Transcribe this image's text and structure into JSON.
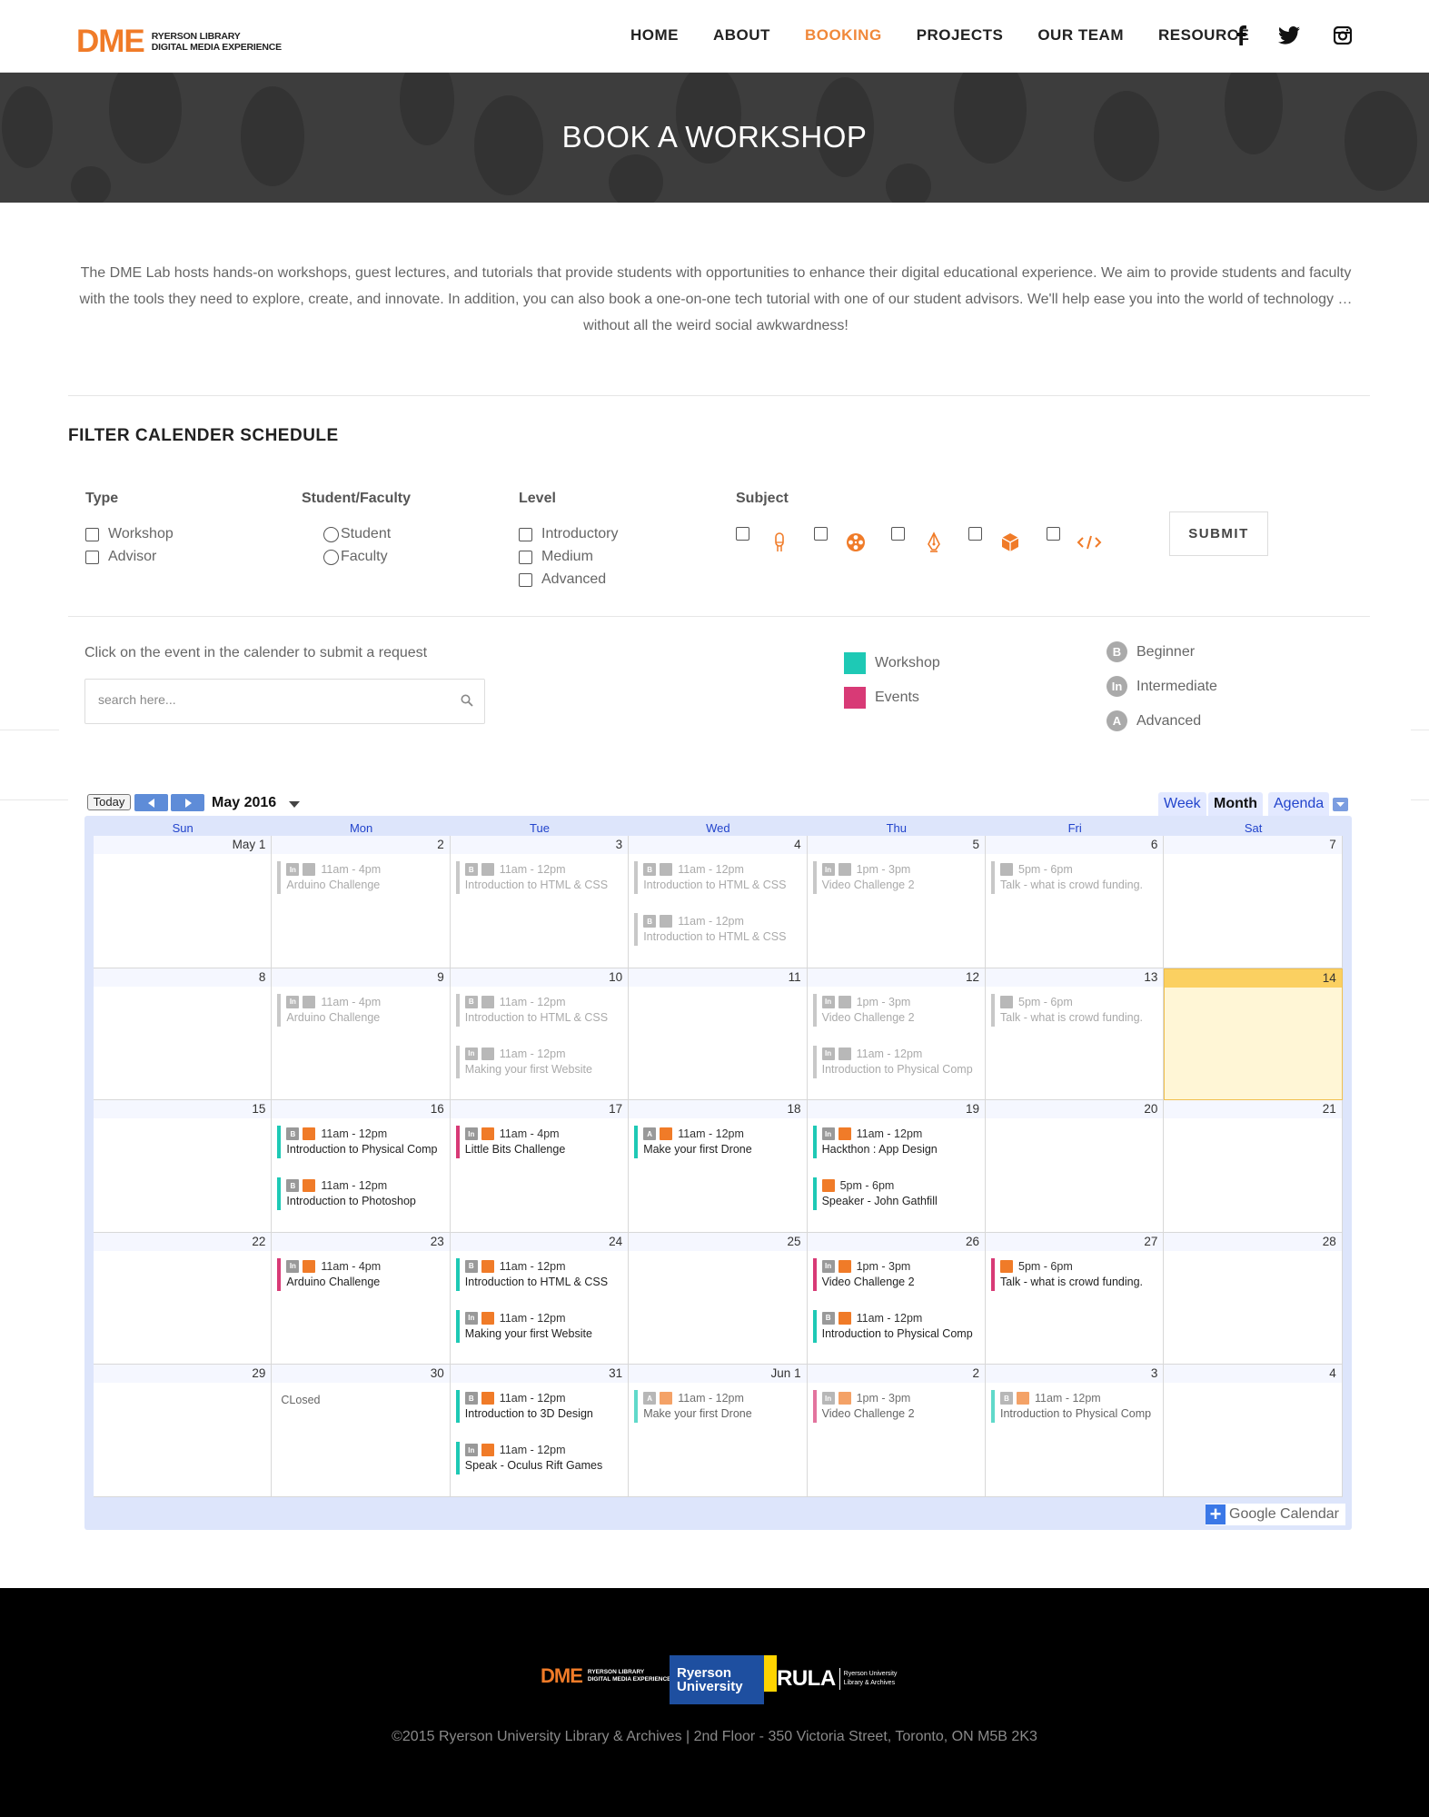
{
  "header": {
    "logo_mark": "DME",
    "logo_line1": "RYERSON LIBRARY",
    "logo_line2": "DIGITAL MEDIA EXPERIENCE",
    "nav": [
      "HOME",
      "ABOUT",
      "BOOKING",
      "PROJECTS",
      "OUR TEAM",
      "RESOURCE"
    ],
    "active_nav": "BOOKING",
    "social_icons": [
      "facebook-icon",
      "twitter-icon",
      "instagram-icon"
    ]
  },
  "hero": {
    "title": "BOOK A WORKSHOP"
  },
  "intro": "The DME Lab hosts hands-on workshops, guest lectures, and tutorials that provide students with opportunities to enhance their digital educational experience. We aim to provide students and faculty with the tools they need to explore, create, and innovate. In addition, you can also book a one-on-one tech tutorial with one of our student advisors. We'll help ease you into the world of technology … without all the weird social awkwardness!",
  "filter": {
    "title": "FILTER CALENDER SCHEDULE",
    "type_label": "Type",
    "type_options": [
      "Workshop",
      "Advisor"
    ],
    "audience_label": "Student/Faculty",
    "audience_options": [
      "Student",
      "Faculty"
    ],
    "level_label": "Level",
    "level_options": [
      "Introductory",
      "Medium",
      "Advanced"
    ],
    "subject_label": "Subject",
    "subject_icons": [
      "electronics-icon",
      "film-reel-icon",
      "pen-nib-icon",
      "cube-icon",
      "code-icon"
    ],
    "submit_label": "SUBMIT"
  },
  "hint": "Click on the event in the calender to submit a request",
  "search": {
    "placeholder": "search here..."
  },
  "legend": {
    "types": [
      {
        "label": "Workshop",
        "color": "#1ec9b5"
      },
      {
        "label": "Events",
        "color": "#d83a76"
      }
    ],
    "levels": [
      {
        "letter": "B",
        "label": "Beginner"
      },
      {
        "letter": "In",
        "label": "Intermediate"
      },
      {
        "letter": "A",
        "label": "Advanced"
      }
    ]
  },
  "calendar": {
    "today_label": "Today",
    "title": "May 2016",
    "views": [
      "Week",
      "Month",
      "Agenda"
    ],
    "selected_view": "Month",
    "days": [
      "Sun",
      "Mon",
      "Tue",
      "Wed",
      "Thu",
      "Fri",
      "Sat"
    ],
    "weeks": [
      [
        "May 1",
        "2",
        "3",
        "4",
        "5",
        "6",
        "7"
      ],
      [
        "8",
        "9",
        "10",
        "11",
        "12",
        "13",
        "14"
      ],
      [
        "15",
        "16",
        "17",
        "18",
        "19",
        "20",
        "21"
      ],
      [
        "22",
        "23",
        "24",
        "25",
        "26",
        "27",
        "28"
      ],
      [
        "29",
        "30",
        "31",
        "Jun 1",
        "2",
        "3",
        "4"
      ]
    ],
    "today_cell": [
      1,
      6
    ],
    "closed_label": "CLosed",
    "badge_text": "Google Calendar",
    "events": [
      {
        "w": 0,
        "d": 1,
        "s": 0,
        "lvl": "In",
        "time": "11am - 4pm",
        "title": "Arduino Challenge",
        "faded": true
      },
      {
        "w": 0,
        "d": 2,
        "s": 0,
        "lvl": "B",
        "time": "11am - 12pm",
        "title": "Introduction to HTML & CSS",
        "faded": true
      },
      {
        "w": 0,
        "d": 3,
        "s": 0,
        "lvl": "B",
        "time": "11am - 12pm",
        "title": "Introduction to HTML & CSS",
        "faded": true
      },
      {
        "w": 0,
        "d": 3,
        "s": 1,
        "lvl": "B",
        "time": "11am - 12pm",
        "title": "Introduction to HTML & CSS",
        "faded": true
      },
      {
        "w": 0,
        "d": 4,
        "s": 0,
        "lvl": "In",
        "time": "1pm - 3pm",
        "title": "Video Challenge 2",
        "faded": true
      },
      {
        "w": 0,
        "d": 5,
        "s": 0,
        "lvl": "",
        "time": "5pm - 6pm",
        "title": "Talk - what is crowd funding.",
        "faded": true
      },
      {
        "w": 1,
        "d": 1,
        "s": 0,
        "lvl": "In",
        "time": "11am - 4pm",
        "title": "Arduino Challenge",
        "faded": true
      },
      {
        "w": 1,
        "d": 2,
        "s": 0,
        "lvl": "B",
        "time": "11am - 12pm",
        "title": "Introduction to HTML & CSS",
        "faded": true
      },
      {
        "w": 1,
        "d": 2,
        "s": 1,
        "lvl": "In",
        "time": "11am - 12pm",
        "title": "Making your first Website",
        "faded": true
      },
      {
        "w": 1,
        "d": 4,
        "s": 0,
        "lvl": "In",
        "time": "1pm - 3pm",
        "title": "Video Challenge 2",
        "faded": true
      },
      {
        "w": 1,
        "d": 4,
        "s": 1,
        "lvl": "In",
        "time": "11am - 12pm",
        "title": "Introduction to Physical Comp",
        "faded": true
      },
      {
        "w": 1,
        "d": 5,
        "s": 0,
        "lvl": "",
        "time": "5pm - 6pm",
        "title": "Talk - what is crowd funding.",
        "faded": true
      },
      {
        "w": 2,
        "d": 1,
        "s": 0,
        "lvl": "B",
        "time": "11am - 12pm",
        "title": "Introduction to Physical Comp",
        "color": "#1ec9b5"
      },
      {
        "w": 2,
        "d": 1,
        "s": 1,
        "lvl": "B",
        "time": "11am - 12pm",
        "title": "Introduction to Photoshop",
        "color": "#1ec9b5"
      },
      {
        "w": 2,
        "d": 2,
        "s": 0,
        "lvl": "In",
        "time": "11am - 4pm",
        "title": "Little Bits Challenge",
        "color": "#d83a76"
      },
      {
        "w": 2,
        "d": 3,
        "s": 0,
        "lvl": "A",
        "time": "11am - 12pm",
        "title": "Make your first Drone",
        "color": "#1ec9b5"
      },
      {
        "w": 2,
        "d": 4,
        "s": 0,
        "lvl": "In",
        "time": "11am - 12pm",
        "title": "Hackthon : App Design",
        "color": "#1ec9b5"
      },
      {
        "w": 2,
        "d": 4,
        "s": 1,
        "lvl": "",
        "time": "5pm - 6pm",
        "title": "Speaker - John Gathfill",
        "color": "#1ec9b5"
      },
      {
        "w": 3,
        "d": 1,
        "s": 0,
        "lvl": "In",
        "time": "11am - 4pm",
        "title": "Arduino Challenge",
        "color": "#d83a76"
      },
      {
        "w": 3,
        "d": 2,
        "s": 0,
        "lvl": "B",
        "time": "11am - 12pm",
        "title": "Introduction to HTML & CSS",
        "color": "#1ec9b5"
      },
      {
        "w": 3,
        "d": 2,
        "s": 1,
        "lvl": "In",
        "time": "11am - 12pm",
        "title": "Making your first Website",
        "color": "#1ec9b5"
      },
      {
        "w": 3,
        "d": 4,
        "s": 0,
        "lvl": "In",
        "time": "1pm - 3pm",
        "title": "Video Challenge 2",
        "color": "#d83a76"
      },
      {
        "w": 3,
        "d": 4,
        "s": 1,
        "lvl": "B",
        "time": "11am - 12pm",
        "title": "Introduction to Physical Comp",
        "color": "#1ec9b5"
      },
      {
        "w": 3,
        "d": 5,
        "s": 0,
        "lvl": "",
        "time": "5pm - 6pm",
        "title": "Talk - what is crowd funding.",
        "color": "#d83a76"
      },
      {
        "w": 4,
        "d": 2,
        "s": 0,
        "lvl": "B",
        "time": "11am - 12pm",
        "title": "Introduction to 3D Design",
        "color": "#1ec9b5"
      },
      {
        "w": 4,
        "d": 2,
        "s": 1,
        "lvl": "In",
        "time": "11am - 12pm",
        "title": "Speak - Oculus Rift Games",
        "color": "#1ec9b5"
      },
      {
        "w": 4,
        "d": 3,
        "s": 0,
        "lvl": "A",
        "time": "11am - 12pm",
        "title": "Make your first Drone",
        "color": "#1ec9b5",
        "dim": true
      },
      {
        "w": 4,
        "d": 4,
        "s": 0,
        "lvl": "In",
        "time": "1pm - 3pm",
        "title": "Video Challenge 2",
        "color": "#d83a76",
        "dim": true
      },
      {
        "w": 4,
        "d": 5,
        "s": 0,
        "lvl": "B",
        "time": "11am - 12pm",
        "title": "Introduction to Physical Comp",
        "color": "#1ec9b5",
        "dim": true
      }
    ]
  },
  "footer": {
    "logo_mark": "DME",
    "logo_line1": "RYERSON LIBRARY",
    "logo_line2": "DIGITAL MEDIA EXPERIENCE",
    "ryerson_line1": "Ryerson",
    "ryerson_line2": "University",
    "rula": "RULA",
    "rula_line1": "Ryerson University",
    "rula_line2": "Library & Archives",
    "copyright": "©2015 Ryerson University Library & Archives | 2nd Floor - 350 Victoria Street, Toronto, ON M5B 2K3"
  }
}
